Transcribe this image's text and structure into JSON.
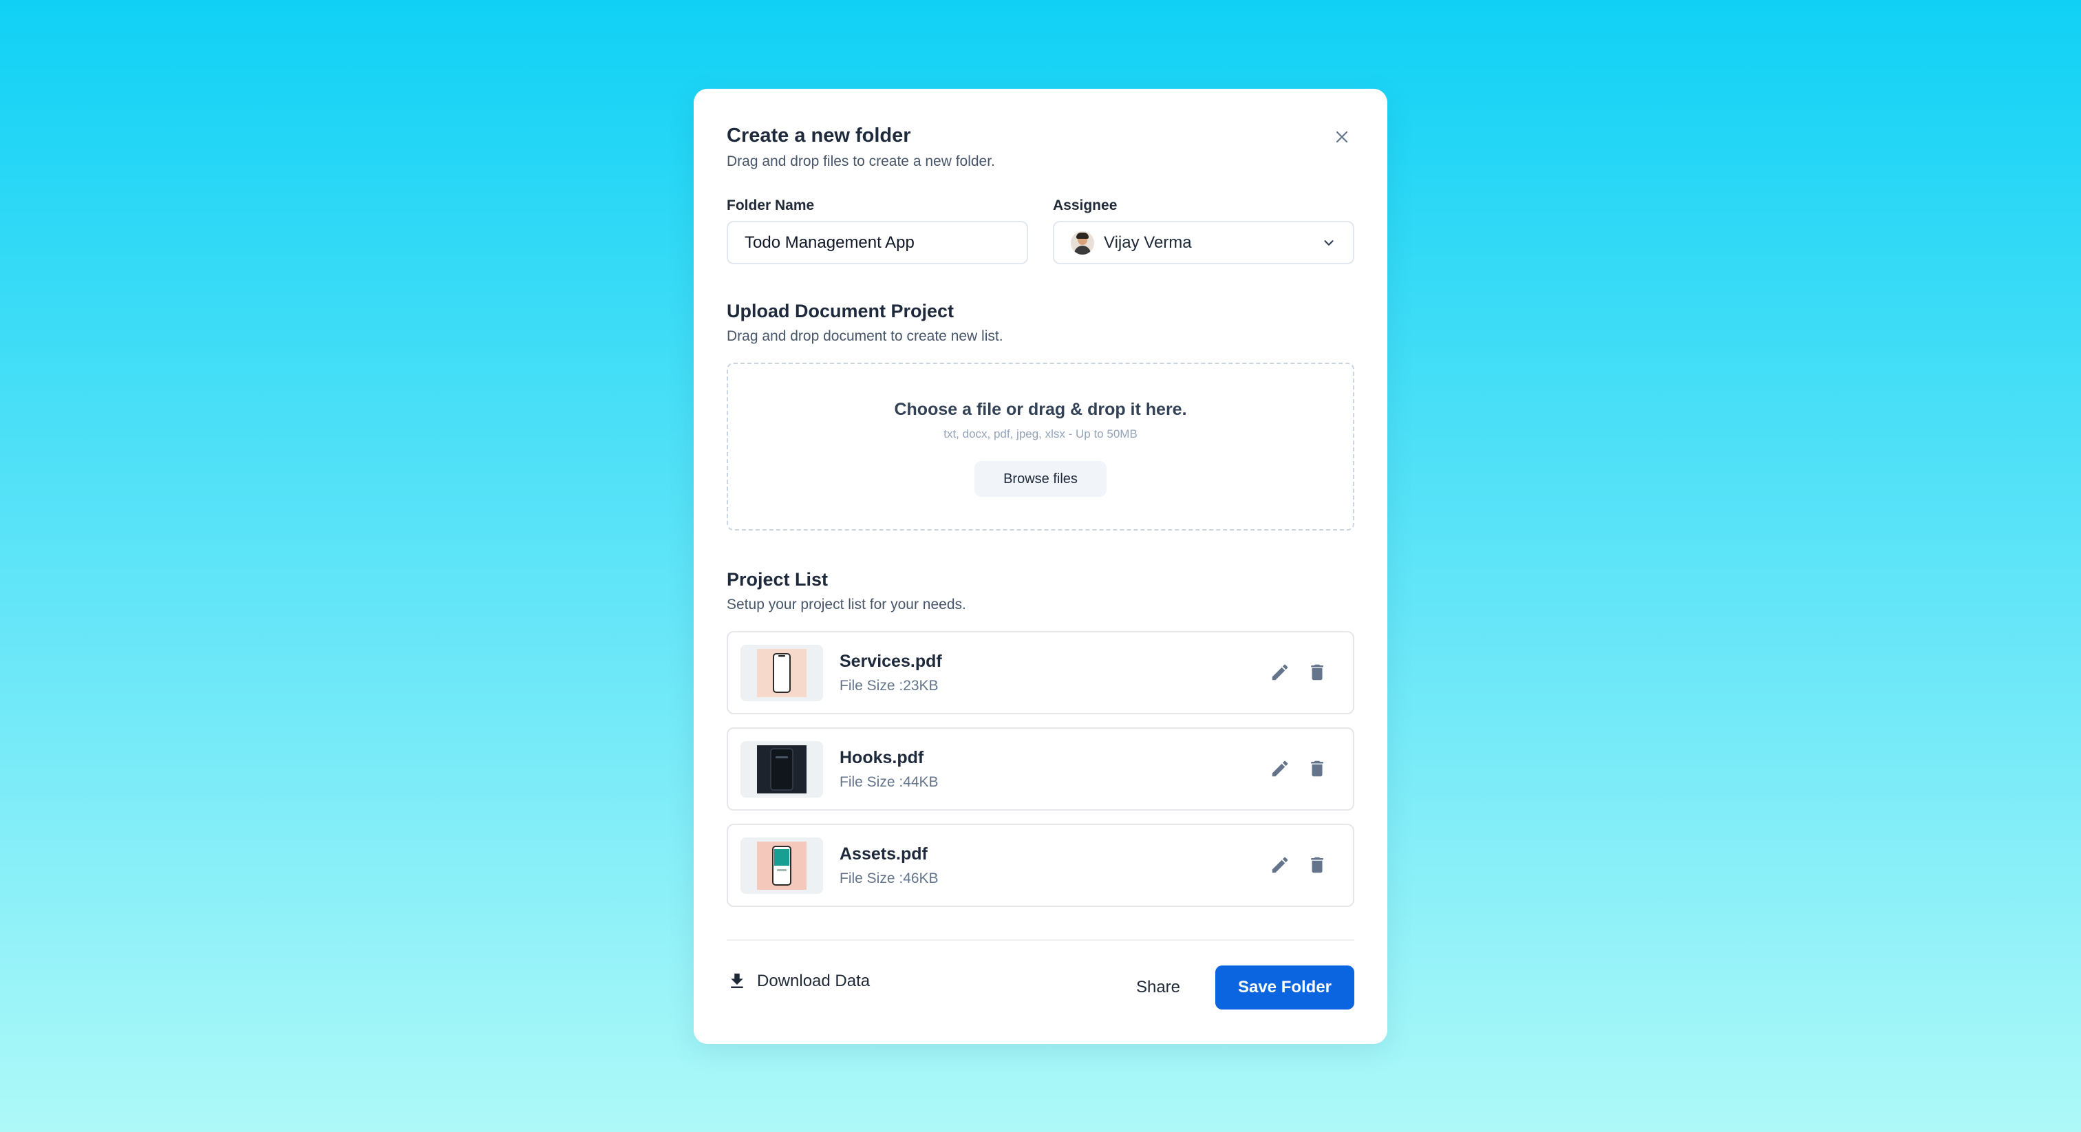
{
  "dialog": {
    "title": "Create a new folder",
    "subtitle": "Drag and drop files to create a new folder."
  },
  "form": {
    "folder_name_label": "Folder Name",
    "folder_name_value": "Todo Management App",
    "assignee_label": "Assignee",
    "assignee_value": "Vijay Verma"
  },
  "upload": {
    "title": "Upload Document Project",
    "subtitle": "Drag and drop document to create new list.",
    "dropzone_title": "Choose a file or drag & drop it here.",
    "dropzone_hint": "txt, docx, pdf, jpeg, xlsx - Up to 50MB",
    "browse_label": "Browse files"
  },
  "project_list": {
    "title": "Project List",
    "subtitle": "Setup your project list for your needs.",
    "files": [
      {
        "name": "Services.pdf",
        "size": "File Size :23KB",
        "thumb": "phone-light"
      },
      {
        "name": "Hooks.pdf",
        "size": "File Size :44KB",
        "thumb": "phone-dark"
      },
      {
        "name": "Assets.pdf",
        "size": "File Size :46KB",
        "thumb": "phone-teal"
      }
    ]
  },
  "footer": {
    "download_label": "Download Data",
    "share_label": "Share",
    "save_label": "Save Folder"
  },
  "colors": {
    "primary": "#0b64e0",
    "background_top": "#10d1f5",
    "background_bottom": "#aef9f8"
  }
}
